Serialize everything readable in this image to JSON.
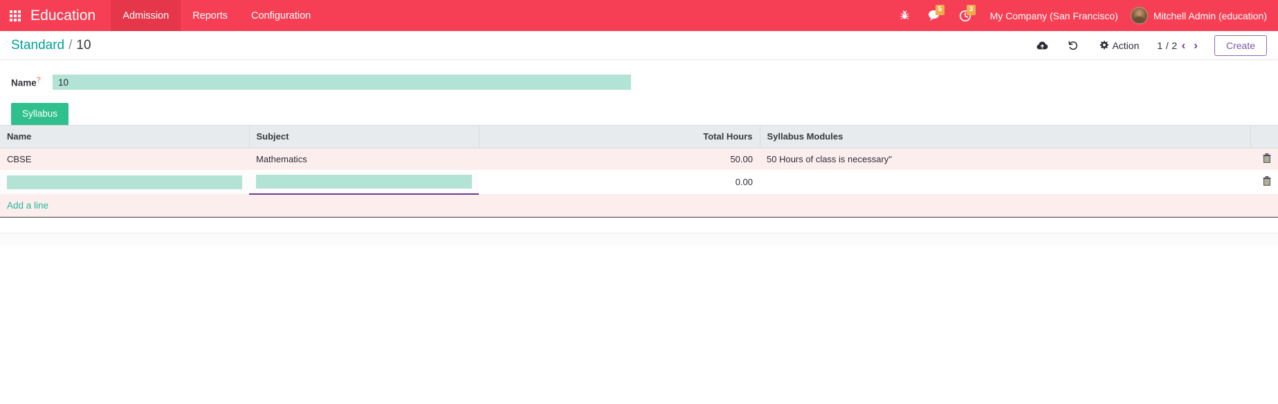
{
  "navbar": {
    "apps_icon": "grid-apps-icon",
    "brand": "Education",
    "menu": [
      {
        "label": "Admission",
        "active": true
      },
      {
        "label": "Reports",
        "active": false
      },
      {
        "label": "Configuration",
        "active": false
      }
    ],
    "icons": [
      {
        "name": "bug-icon",
        "badge": null
      },
      {
        "name": "messaging-chat-icon",
        "badge": "5"
      },
      {
        "name": "activities-clock-icon",
        "badge": "3"
      }
    ],
    "company": "My Company (San Francisco)",
    "user": "Mitchell Admin (education)",
    "avatar_name": "user-avatar",
    "background_color": "#f63f54",
    "active_item_color": "#e5364a",
    "badge_color": "#f0ad4e"
  },
  "control_panel": {
    "breadcrumb": {
      "root": "Standard",
      "separator": "/",
      "current": "10"
    },
    "save_icon": "cloud-upload-save-icon",
    "discard_icon": "undo-discard-icon",
    "action_icon": "gear-icon",
    "action_label": "Action",
    "pager": {
      "value": "1 / 2",
      "prev_icon": "chevron-left-icon",
      "next_icon": "chevron-right-icon"
    },
    "create_label": "Create",
    "link_color": "#00a09d",
    "create_color": "#7d57a5"
  },
  "form": {
    "name_field": {
      "label": "Name",
      "required_marker": "?",
      "value": "10",
      "placeholder": ""
    },
    "notebook": {
      "tabs": [
        {
          "label": "Syllabus",
          "active": true
        }
      ]
    },
    "table": {
      "columns": [
        {
          "label": "Name",
          "align": "left"
        },
        {
          "label": "Subject",
          "align": "left"
        },
        {
          "label": "Total Hours",
          "align": "right"
        },
        {
          "label": "Syllabus Modules",
          "align": "left"
        }
      ],
      "rows": [
        {
          "name": "CBSE",
          "subject": "Mathematics",
          "total_hours": "50.00",
          "syllabus_modules": "50 Hours of class is necessary\"",
          "delete_icon": "trash-icon"
        }
      ],
      "edit_row": {
        "name_value": "",
        "name_placeholder": "",
        "subject_value": "",
        "subject_placeholder": "",
        "total_hours": "0.00",
        "syllabus_modules": "",
        "delete_icon": "trash-icon"
      },
      "add_line_label": "Add a line",
      "add_line_color": "#21b799",
      "row_background": "#fdeeee",
      "header_background": "#e7ebee",
      "input_background": "#b2e3d4",
      "focus_underline_color": "#6a3a8f"
    }
  }
}
